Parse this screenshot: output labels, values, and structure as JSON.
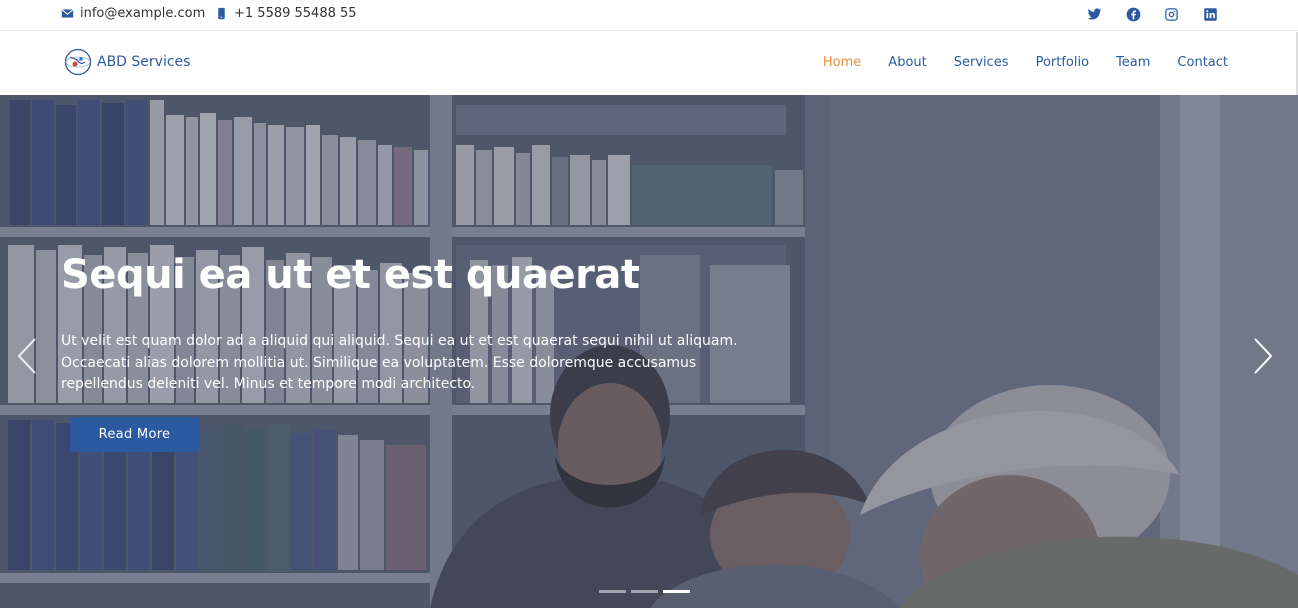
{
  "topbar": {
    "email": "info@example.com",
    "phone": "+1 5589 55488 55",
    "social": [
      "twitter-icon",
      "facebook-icon",
      "instagram-icon",
      "linkedin-icon"
    ]
  },
  "header": {
    "brand": "ABD Services",
    "nav": [
      {
        "label": "Home",
        "active": true
      },
      {
        "label": "About",
        "active": false
      },
      {
        "label": "Services",
        "active": false
      },
      {
        "label": "Portfolio",
        "active": false
      },
      {
        "label": "Team",
        "active": false
      },
      {
        "label": "Contact",
        "active": false
      }
    ]
  },
  "hero": {
    "title": "Sequi ea ut et est quaerat",
    "text": "Ut velit est quam dolor ad a aliquid qui aliquid. Sequi ea ut et est quaerat sequi nihil ut aliquam. Occaecati alias dolorem mollitia ut. Similique ea voluptatem. Esse doloremque accusamus repellendus deleniti vel. Minus et tempore modi architecto.",
    "button": "Read More",
    "slides": 3,
    "active_slide": 3
  },
  "colors": {
    "accent": "#2c5aa0",
    "active_nav": "#e8903a",
    "hero_overlay": "#4a5268"
  }
}
